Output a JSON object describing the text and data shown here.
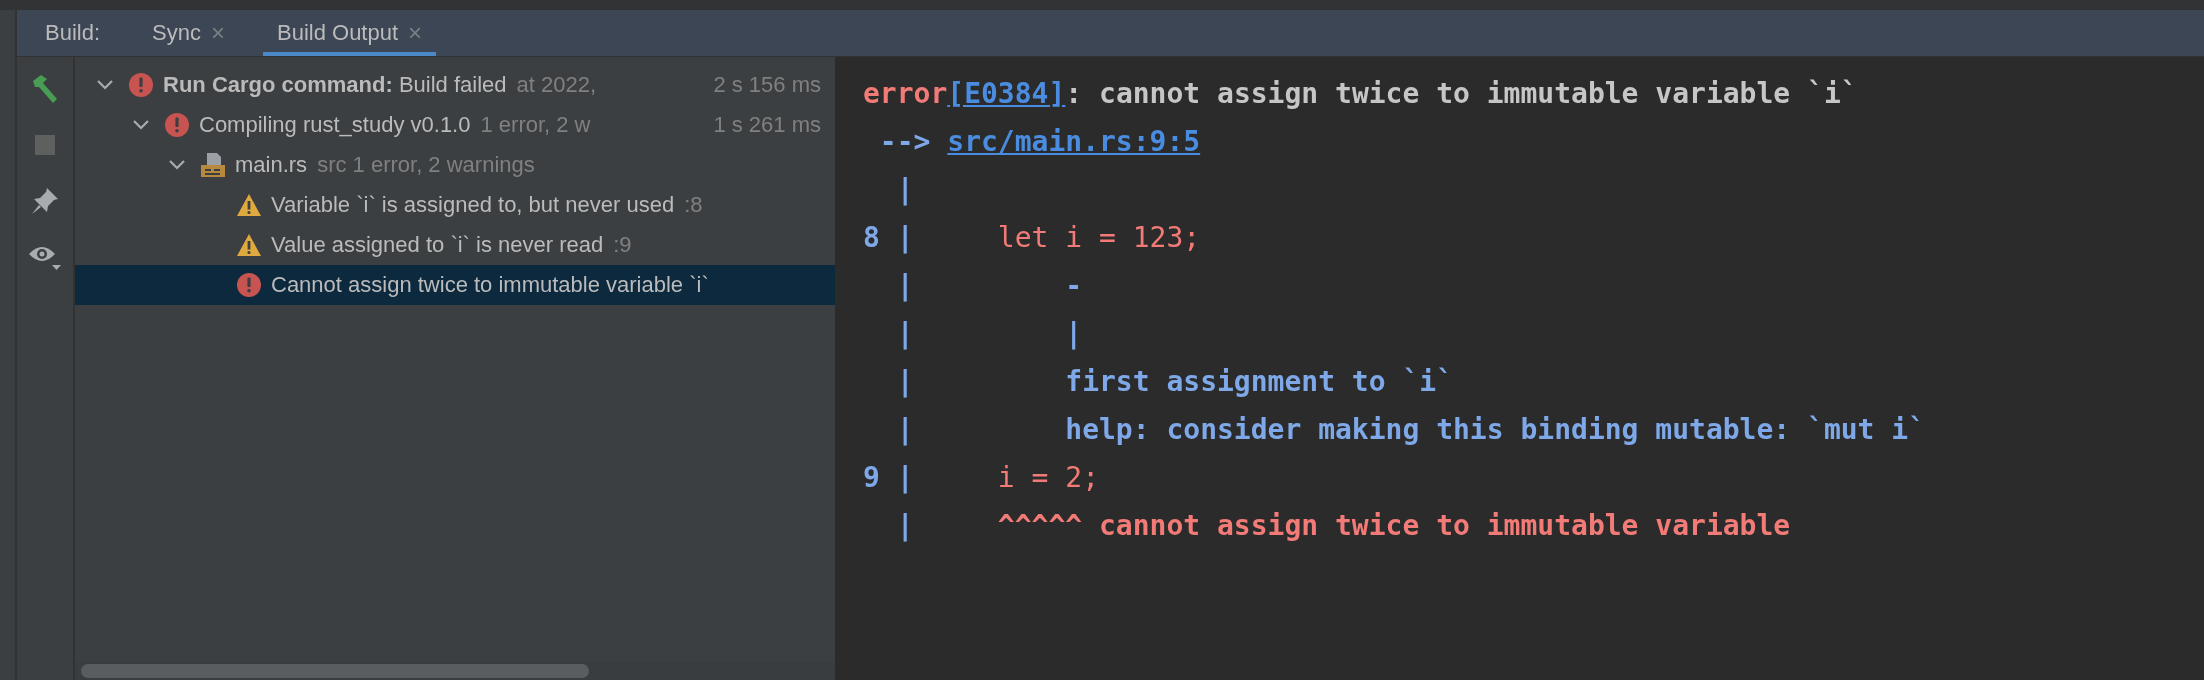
{
  "tool_window": {
    "title": "Build:",
    "tabs": [
      {
        "label": "Sync",
        "selected": false,
        "close": "×"
      },
      {
        "label": "Build Output",
        "selected": true,
        "close": "×"
      }
    ]
  },
  "tree": [
    {
      "kind": "error",
      "label": "**Run Cargo command:** Build failed",
      "detail": "at 2022,",
      "time": "2 s 156 ms",
      "expanded": true,
      "selected": false,
      "children": [
        {
          "kind": "error",
          "label": "Compiling rust_study v0.1.0",
          "detail": "1 error, 2 w",
          "time": "1 s 261 ms",
          "expanded": true,
          "selected": false,
          "children": [
            {
              "kind": "file",
              "label": "main.rs",
              "detail": "src 1 error, 2 warnings",
              "expanded": true,
              "selected": false,
              "children": [
                {
                  "kind": "warning",
                  "label": "Variable `i` is assigned to, but never used",
                  "detail": ":8",
                  "selected": false
                },
                {
                  "kind": "warning",
                  "label": "Value assigned to `i` is never read",
                  "detail": ":9",
                  "selected": false
                },
                {
                  "kind": "error",
                  "label": "Cannot assign twice to immutable variable `i`",
                  "selected": true
                }
              ]
            }
          ]
        }
      ]
    }
  ],
  "console": [
    {
      "segments": [
        {
          "kind": "error",
          "text": "error"
        },
        {
          "kind": "link",
          "text": "[E0384]"
        },
        {
          "kind": "message",
          "text": ": cannot assign twice to immutable variable `i`"
        }
      ]
    },
    {
      "segments": [
        {
          "kind": "gutter",
          "text": " --> "
        },
        {
          "kind": "link",
          "text": "src/main.rs:9:5"
        }
      ]
    },
    {
      "segments": [
        {
          "kind": "gutter",
          "text": "  |"
        }
      ]
    },
    {
      "segments": [
        {
          "kind": "gutter",
          "text": "8 |"
        },
        {
          "kind": "code",
          "text": "     let i = 123;"
        }
      ]
    },
    {
      "segments": [
        {
          "kind": "gutter",
          "text": "  |"
        },
        {
          "kind": "note",
          "text": "         -"
        }
      ]
    },
    {
      "segments": [
        {
          "kind": "gutter",
          "text": "  |"
        },
        {
          "kind": "note",
          "text": "         |"
        }
      ]
    },
    {
      "segments": [
        {
          "kind": "gutter",
          "text": "  |"
        },
        {
          "kind": "note",
          "text": "         first assignment to `i`"
        }
      ]
    },
    {
      "segments": [
        {
          "kind": "gutter",
          "text": "  |"
        },
        {
          "kind": "note",
          "text": "         help: consider making this binding mutable: `mut i`"
        }
      ]
    },
    {
      "segments": [
        {
          "kind": "gutter",
          "text": "9 |"
        },
        {
          "kind": "code",
          "text": "     i = 2;"
        }
      ]
    },
    {
      "segments": [
        {
          "kind": "gutter",
          "text": "  |"
        },
        {
          "kind": "error",
          "text": "     ^^^^^ cannot assign twice to immutable variable"
        }
      ]
    }
  ]
}
